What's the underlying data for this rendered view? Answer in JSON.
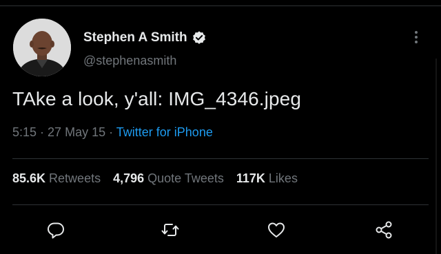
{
  "author": {
    "display_name": "Stephen A Smith",
    "handle": "@stephenasmith",
    "verified": true
  },
  "tweet": {
    "text": "TAke a look, y'all: IMG_4346.jpeg",
    "time": "5:15",
    "separator_1": " · ",
    "date": "27 May 15",
    "separator_2": " · ",
    "source": "Twitter for iPhone"
  },
  "stats": {
    "retweets_count": "85.6K",
    "retweets_label": "Retweets",
    "quotes_count": "4,796",
    "quotes_label": "Quote Tweets",
    "likes_count": "117K",
    "likes_label": "Likes"
  },
  "icons": {
    "verified": "verified-badge-icon",
    "more": "more-vertical-icon",
    "reply": "reply-icon",
    "retweet": "retweet-icon",
    "like": "heart-icon",
    "share": "share-icon"
  },
  "colors": {
    "background": "#000000",
    "text": "#e7e9ea",
    "secondary_text": "#71767b",
    "link": "#1d9bf0",
    "divider": "#2f3336"
  }
}
